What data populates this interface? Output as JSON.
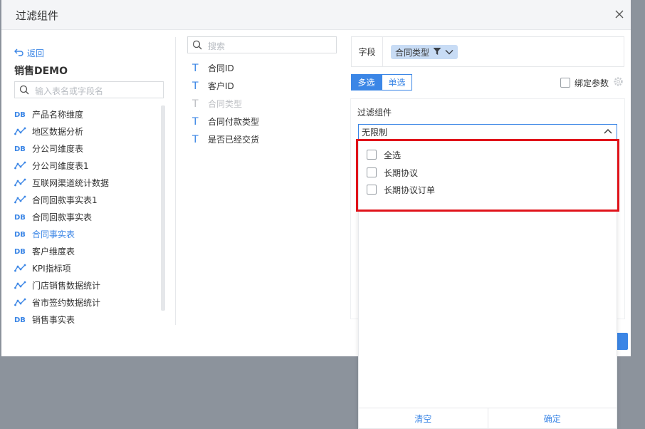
{
  "dialog": {
    "title": "过滤组件"
  },
  "left": {
    "back_label": "返回",
    "package_title": "销售DEMO",
    "search_placeholder": "输入表名或字段名",
    "tables": [
      {
        "label": "产品名称维度",
        "icon": "db-table-icon",
        "active": false
      },
      {
        "label": "地区数据分析",
        "icon": "analysis-table-icon",
        "active": false
      },
      {
        "label": "分公司维度表",
        "icon": "db-table-icon",
        "active": false
      },
      {
        "label": "分公司维度表1",
        "icon": "analysis-table-icon",
        "active": false
      },
      {
        "label": "互联网渠道统计数据",
        "icon": "analysis-table-icon",
        "active": false
      },
      {
        "label": "合同回款事实表1",
        "icon": "analysis-table-icon",
        "active": false
      },
      {
        "label": "合同回款事实表",
        "icon": "db-table-icon",
        "active": false
      },
      {
        "label": "合同事实表",
        "icon": "db-table-icon",
        "active": true
      },
      {
        "label": "客户维度表",
        "icon": "db-table-icon",
        "active": false
      },
      {
        "label": "KPI指标项",
        "icon": "analysis-table-icon",
        "active": false
      },
      {
        "label": "门店销售数据统计",
        "icon": "analysis-table-icon",
        "active": false
      },
      {
        "label": "省市签约数据统计",
        "icon": "analysis-table-icon",
        "active": false
      },
      {
        "label": "销售事实表",
        "icon": "db-table-icon",
        "active": false
      }
    ]
  },
  "middle": {
    "search_placeholder": "搜索",
    "fields": [
      {
        "label": "合同ID",
        "type_glyph": "T",
        "disabled": false
      },
      {
        "label": "客户ID",
        "type_glyph": "T",
        "disabled": false
      },
      {
        "label": "合同类型",
        "type_glyph": "T",
        "disabled": true
      },
      {
        "label": "合同付款类型",
        "type_glyph": "T",
        "disabled": false
      },
      {
        "label": "是否已经交货",
        "type_glyph": "T",
        "disabled": false
      }
    ]
  },
  "right": {
    "field_label": "字段",
    "field_tag": "合同类型",
    "mode_multi": "多选",
    "mode_single": "单选",
    "bind_param": "绑定参数",
    "filter_label": "过滤组件",
    "select_value": "无限制",
    "options": [
      "全选",
      "长期协议",
      "长期协议订单"
    ],
    "footer_clear": "清空",
    "footer_confirm": "确定"
  },
  "colors": {
    "accent": "#3b86e6",
    "highlight": "#e0131a"
  }
}
